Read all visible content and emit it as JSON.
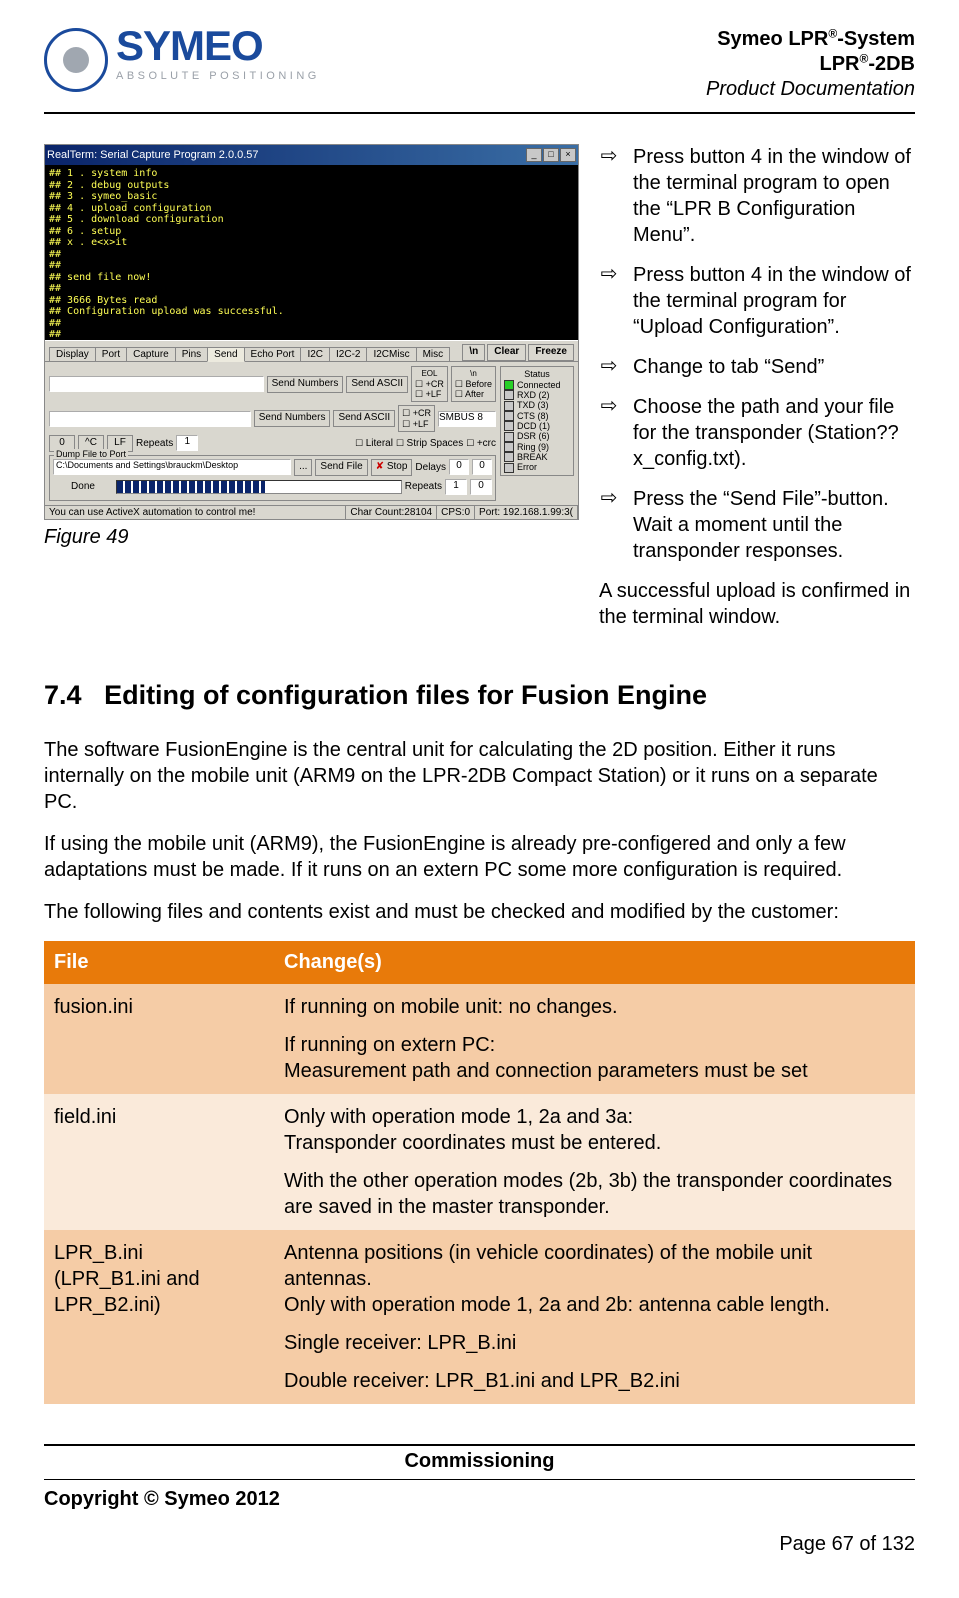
{
  "header": {
    "logo_main": "SYMEO",
    "logo_sub": "ABSOLUTE POSITIONING",
    "line1_pre": "Symeo LPR",
    "line1_post": "-System",
    "line2_pre": "LPR",
    "line2_post": "-2DB",
    "line3": "Product Documentation"
  },
  "screenshot": {
    "title": "RealTerm: Serial Capture Program 2.0.0.57",
    "terminal_lines": "## 1 . system info\n## 2 . debug outputs\n## 3 . symeo_basic\n## 4 . upload configuration\n## 5 . download configuration\n## 6 . setup\n## x . e<x>it\n##\n##\n## send file now!\n##\n## 3666 Bytes read\n## Configuration upload was successful.\n##\n##",
    "tabs": [
      "Display",
      "Port",
      "Capture",
      "Pins",
      "Send",
      "Echo Port",
      "I2C",
      "I2C-2",
      "I2CMisc",
      "Misc"
    ],
    "active_tab": "Send",
    "btn_n": "\\n",
    "btn_clear": "Clear",
    "btn_freeze": "Freeze",
    "send_numbers": "Send Numbers",
    "send_ascii": "Send ASCII",
    "eol_label": "EOL",
    "eol_opts": [
      "+CR",
      "+LF",
      "+CR",
      "+LF"
    ],
    "n_label": "\\n",
    "before": "Before",
    "after": "After",
    "smbus": "SMBUS 8",
    "zero": "0",
    "c_pre": "^C",
    "lf_pre": "LF",
    "repeats": "Repeats",
    "repeats_val": "1",
    "literal": "Literal",
    "strip": "Strip Spaces",
    "plus_crc": "+crc",
    "dump_label": "Dump File to Port",
    "dump_path": "C:\\Documents and Settings\\brauckm\\Desktop",
    "dots": "...",
    "send_file": "Send File",
    "x_icon": "✘",
    "stop": "Stop",
    "delays": "Delays",
    "delay0": "0",
    "done": "Done",
    "rep2": "Repeats",
    "rep2_val": "1",
    "status_label": "Status",
    "status_items": [
      "Connected",
      "RXD (2)",
      "TXD (3)",
      "CTS (8)",
      "DCD (1)",
      "DSR (6)",
      "Ring (9)",
      "BREAK",
      "Error"
    ],
    "sb_left": "You can use ActiveX automation to control me!",
    "sb_chars": "Char Count:28104",
    "sb_cps": "CPS:0",
    "sb_port": "Port: 192.168.1.99:3("
  },
  "figure_caption": "Figure 49",
  "instructions": [
    "Press button 4 in the window of the terminal program to open the “LPR B Configuration Menu”.",
    "Press button 4 in the window of the terminal program for “Upload Configuration”.",
    "Change to tab “Send”",
    "Choose the path and your file for the transponder (Station??x_config.txt).",
    "Press the “Send File”-button. Wait a moment until the transponder responses."
  ],
  "note": "A successful upload is confirmed in the terminal window.",
  "section": {
    "number": "7.4",
    "title": "Editing of configuration files for Fusion Engine"
  },
  "paragraphs": [
    "The software FusionEngine is the central unit for calculating the 2D position. Either it runs internally on the mobile unit (ARM9 on the LPR-2DB Compact Station) or it runs on a separate PC.",
    "If using the mobile unit (ARM9), the FusionEngine is already pre-configered and only a few adaptations must be made. If it runs on an extern PC some more configuration is required.",
    "The following files and contents exist and must be checked and modified by the customer:"
  ],
  "table": {
    "head_file": "File",
    "head_change": "Change(s)",
    "rows": [
      {
        "file": "fusion.ini",
        "changes": [
          "If running on mobile unit: no changes.",
          "If running on extern PC:\nMeasurement path and connection parameters must be set"
        ]
      },
      {
        "file": "field.ini",
        "changes": [
          "Only with operation mode 1, 2a and 3a:\nTransponder coordinates must be entered.",
          "With the other operation modes (2b, 3b) the transponder coordinates are saved in the master transponder."
        ]
      },
      {
        "file": "LPR_B.ini\n(LPR_B1.ini and LPR_B2.ini)",
        "changes": [
          "Antenna positions (in vehicle coordinates) of the mobile unit antennas.\nOnly with operation mode 1, 2a and 2b: antenna cable length.",
          "Single receiver: LPR_B.ini",
          "Double receiver: LPR_B1.ini and LPR_B2.ini"
        ]
      }
    ]
  },
  "footer": {
    "section": "Commissioning",
    "copyright": "Copyright © Symeo 2012",
    "page": "Page 67 of 132"
  }
}
